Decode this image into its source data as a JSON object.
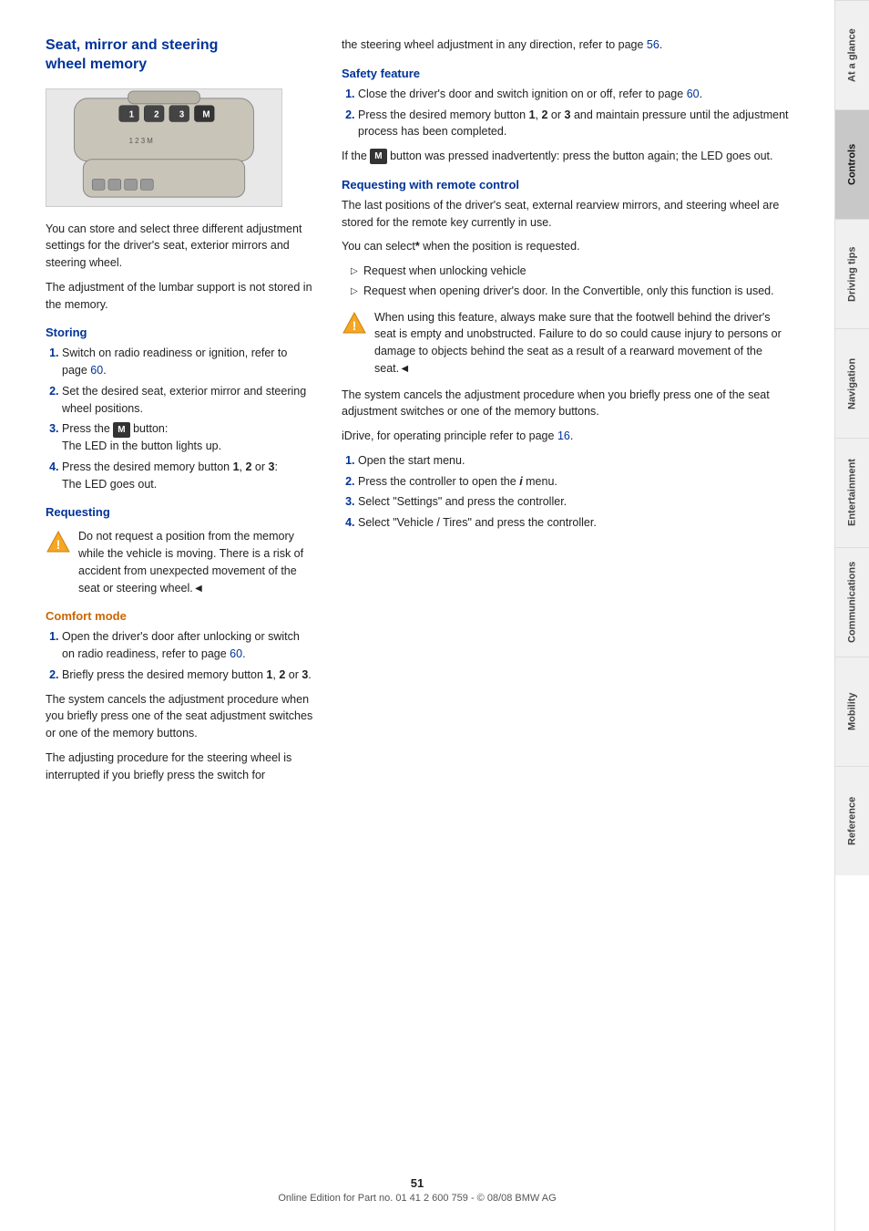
{
  "page": {
    "number": "51",
    "footer_text": "Online Edition for Part no. 01 41 2 600 759 - © 08/08 BMW AG"
  },
  "sidebar": {
    "tabs": [
      {
        "id": "at-a-glance",
        "label": "At a glance",
        "active": false
      },
      {
        "id": "controls",
        "label": "Controls",
        "active": true
      },
      {
        "id": "driving-tips",
        "label": "Driving tips",
        "active": false
      },
      {
        "id": "navigation",
        "label": "Navigation",
        "active": false
      },
      {
        "id": "entertainment",
        "label": "Entertainment",
        "active": false
      },
      {
        "id": "communications",
        "label": "Communications",
        "active": false
      },
      {
        "id": "mobility",
        "label": "Mobility",
        "active": false
      },
      {
        "id": "reference",
        "label": "Reference",
        "active": false
      }
    ]
  },
  "left_column": {
    "title": "Seat, mirror and steering\nwheel memory",
    "intro_paragraphs": [
      "You can store and select three different adjustment settings for the driver's seat, exterior mirrors and steering wheel.",
      "The adjustment of the lumbar support is not stored in the memory."
    ],
    "storing": {
      "heading": "Storing",
      "steps": [
        {
          "num": 1,
          "text": "Switch on radio readiness or ignition, refer to page 60."
        },
        {
          "num": 2,
          "text": "Set the desired seat, exterior mirror and steering wheel positions."
        },
        {
          "num": 3,
          "text": "Press the M button:\nThe LED in the button lights up."
        },
        {
          "num": 4,
          "text": "Press the desired memory button 1, 2 or 3:\nThe LED goes out."
        }
      ]
    },
    "requesting": {
      "heading": "Requesting",
      "warning": "Do not request a position from the memory while the vehicle is moving. There is a risk of accident from unexpected movement of the seat or steering wheel.◄"
    },
    "comfort_mode": {
      "heading": "Comfort mode",
      "steps": [
        {
          "num": 1,
          "text": "Open the driver's door after unlocking or switch on radio readiness, refer to page 60."
        },
        {
          "num": 2,
          "text": "Briefly press the desired memory button 1, 2 or 3."
        }
      ],
      "note1": "The system cancels the adjustment procedure when you briefly press one of the seat adjustment switches or one of the memory buttons.",
      "note2": "The adjusting procedure for the steering wheel is interrupted if you briefly press the switch for"
    }
  },
  "right_column": {
    "intro": "the steering wheel adjustment in any direction, refer to page 56.",
    "safety_feature": {
      "heading": "Safety feature",
      "steps": [
        {
          "num": 1,
          "text": "Close the driver's door and switch ignition on or off, refer to page 60."
        },
        {
          "num": 2,
          "text": "Press the desired memory button 1, 2 or 3 and maintain pressure until the adjustment process has been completed."
        }
      ],
      "note": "If the M button was pressed inadvertently: press the button again; the LED goes out."
    },
    "requesting_remote": {
      "heading": "Requesting with remote control",
      "intro": "The last positions of the driver's seat, external rearview mirrors, and steering wheel are stored for the remote key currently in use.",
      "select_note": "You can select* when the position is requested.",
      "bullets": [
        "Request when unlocking vehicle",
        "Request when opening driver's door. In the Convertible, only this function is used."
      ],
      "warning": "When using this feature, always make sure that the footwell behind the driver's seat is empty and unobstructed. Failure to do so could cause injury to persons or damage to objects behind the seat as a result of a rearward movement of the seat.◄",
      "cancel_note": "The system cancels the adjustment procedure when you briefly press one of the seat adjustment switches or one of the memory buttons.",
      "idrive_note": "iDrive, for operating principle refer to page 16.",
      "steps": [
        {
          "num": 1,
          "text": "Open the start menu."
        },
        {
          "num": 2,
          "text": "Press the controller to open the i menu."
        },
        {
          "num": 3,
          "text": "Select \"Settings\" and press the controller."
        },
        {
          "num": 4,
          "text": "Select \"Vehicle / Tires\" and press the controller."
        }
      ]
    }
  }
}
